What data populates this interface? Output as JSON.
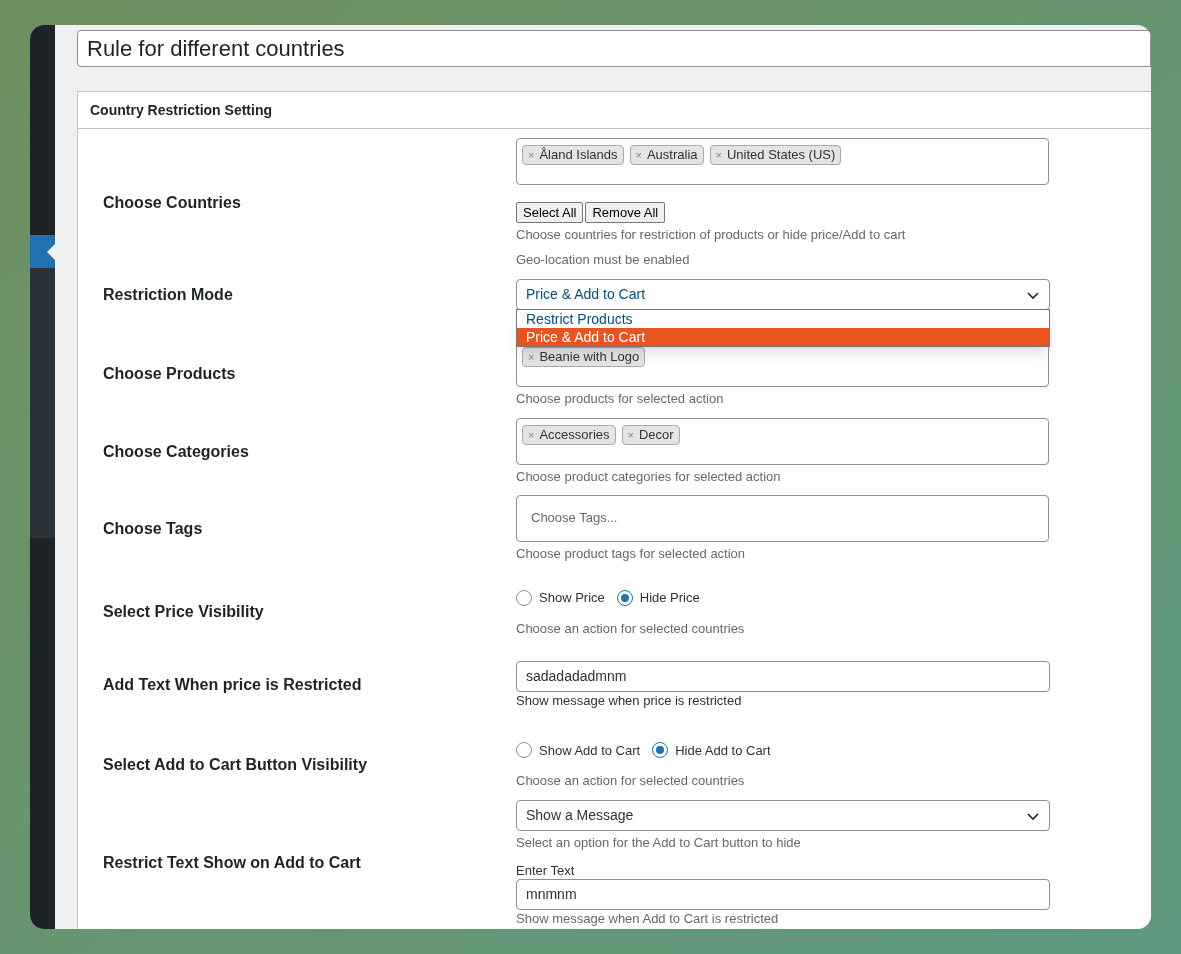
{
  "title_field": {
    "value": "Rule for different countries"
  },
  "panel": {
    "title": "Country Restriction Setting"
  },
  "rows": [
    {
      "kind": "tags",
      "label": "Choose Countries",
      "tags": [
        {
          "remove": "×",
          "label": "Åland Islands"
        },
        {
          "remove": "×",
          "label": "Australia"
        },
        {
          "remove": "×",
          "label": "United States (US)"
        }
      ],
      "buttons": [
        "Select All",
        "Remove All"
      ],
      "notes": [
        "Choose countries for restriction of products or hide price/Add to cart",
        "Geo-location must be enabled"
      ]
    },
    {
      "kind": "select",
      "label": "Restriction Mode",
      "value": "Price & Add to Cart",
      "expanded": true,
      "options": [
        {
          "label": "Restrict Products",
          "selected": false
        },
        {
          "label": "Price & Add to Cart",
          "selected": true
        }
      ]
    },
    {
      "kind": "tags",
      "label": "Choose Products",
      "tags": [
        {
          "remove": "×",
          "label": "Beanie with Logo"
        }
      ],
      "notes": [
        "Choose products for selected action"
      ]
    },
    {
      "kind": "tags",
      "label": "Choose Categories",
      "tags": [
        {
          "remove": "×",
          "label": "Accessories"
        },
        {
          "remove": "×",
          "label": "Decor"
        }
      ],
      "notes": [
        "Choose product categories for selected action"
      ]
    },
    {
      "kind": "tags",
      "label": "Choose Tags",
      "placeholder": "Choose Tags...",
      "notes": [
        "Choose product tags for selected action"
      ]
    },
    {
      "kind": "radio",
      "label": "Select Price Visibility",
      "options": [
        {
          "label": "Show Price",
          "selected": false
        },
        {
          "label": "Hide Price",
          "selected": true
        }
      ],
      "notes": [
        "Choose an action for selected countries"
      ]
    },
    {
      "kind": "text",
      "label": "Add Text When price is Restricted",
      "value": "sadadadadmnm",
      "notes": [
        "Show message when price is restricted"
      ]
    },
    {
      "kind": "radio",
      "label": "Select Add to Cart Button Visibility",
      "options": [
        {
          "label": "Show Add to Cart",
          "selected": false
        },
        {
          "label": "Hide Add to Cart",
          "selected": true
        }
      ],
      "notes": [
        "Choose an action for selected countries"
      ]
    },
    {
      "kind": "select",
      "label": "Restrict Text Show on Add to Cart",
      "value": "Show a Message",
      "expanded": false,
      "notes": [
        "Select an option for the Add to Cart button to hide"
      ],
      "subfield": {
        "label": "Enter Text",
        "value": "mnmnm",
        "note": "Show message when Add to Cart is restricted"
      }
    }
  ]
}
